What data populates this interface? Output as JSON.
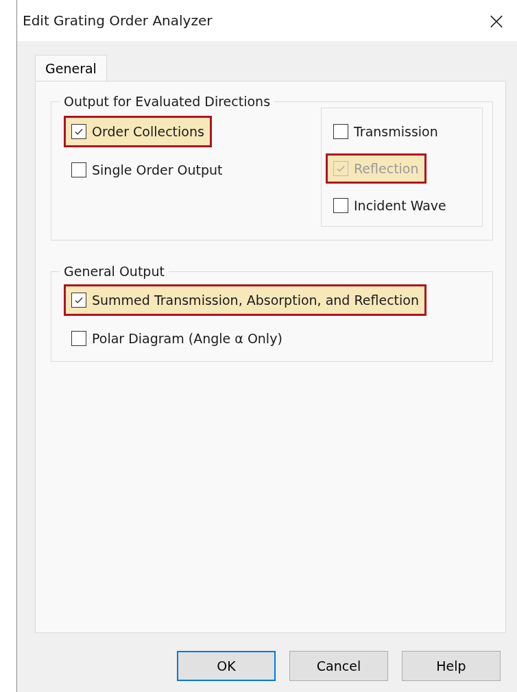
{
  "window": {
    "title": "Edit Grating Order Analyzer",
    "close": "×"
  },
  "tabs": [
    {
      "label": "General",
      "selected": true
    }
  ],
  "groups": [
    {
      "title": "Output for Evaluated Directions",
      "left": [
        {
          "label": "Order Collections",
          "checked": true,
          "disabled": false,
          "highlighted": true
        },
        {
          "label": "Single Order Output",
          "checked": false,
          "disabled": false,
          "highlighted": false
        }
      ],
      "right": [
        {
          "label": "Transmission",
          "checked": false,
          "disabled": false,
          "highlighted": false
        },
        {
          "label": "Reflection",
          "checked": true,
          "disabled": true,
          "highlighted": true
        },
        {
          "label": "Incident Wave",
          "checked": false,
          "disabled": false,
          "highlighted": false
        }
      ]
    },
    {
      "title": "General Output",
      "left": [
        {
          "label": "Summed Transmission, Absorption, and Reflection",
          "checked": true,
          "disabled": false,
          "highlighted": true
        },
        {
          "label": "Polar Diagram (Angle α Only)",
          "checked": false,
          "disabled": false,
          "highlighted": false
        }
      ]
    }
  ],
  "buttons": [
    {
      "label": "OK",
      "default": true
    },
    {
      "label": "Cancel",
      "default": false
    },
    {
      "label": "Help",
      "default": false
    }
  ]
}
